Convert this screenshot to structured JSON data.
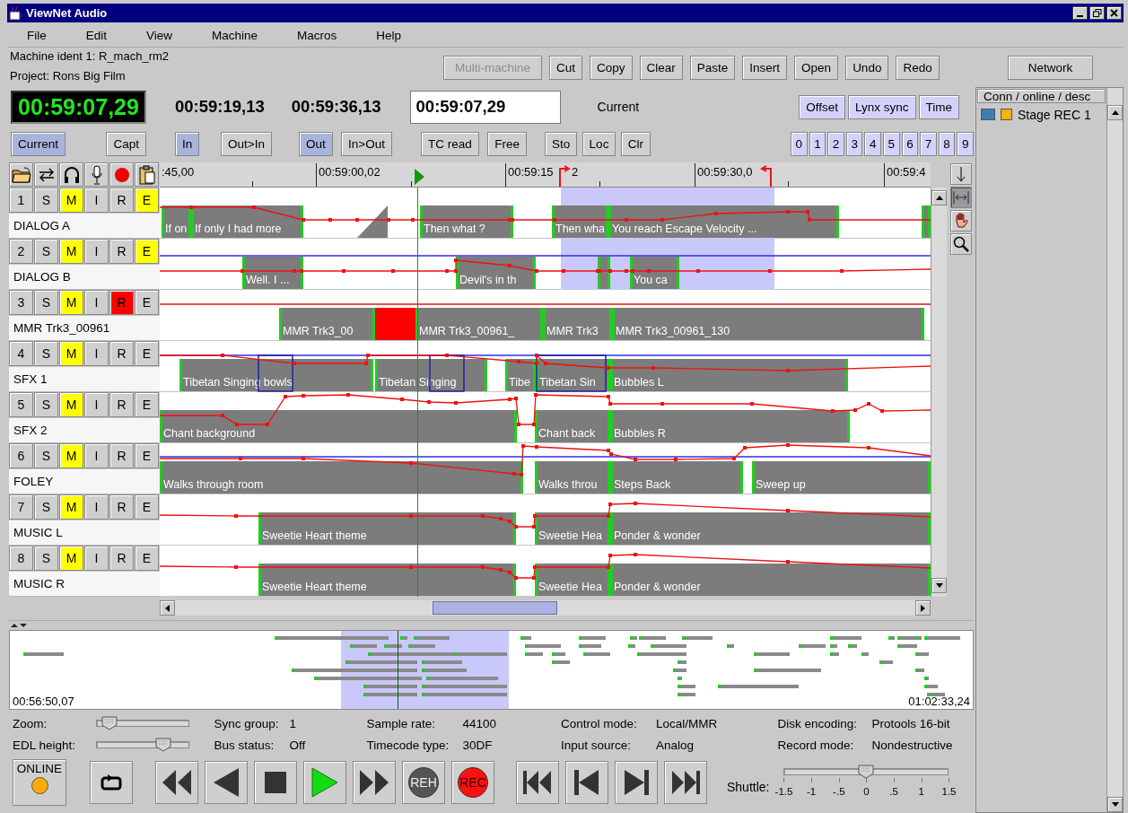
{
  "window": {
    "title": "ViewNet Audio"
  },
  "menu": [
    "File",
    "Edit",
    "View",
    "Machine",
    "Macros",
    "Help"
  ],
  "machine_ident": "Machine ident 1: R_mach_rm2",
  "project": "Project: Rons Big Film",
  "edit_buttons": [
    {
      "label": "Multi-machine",
      "disabled": true
    },
    {
      "label": "Cut",
      "disabled": false
    },
    {
      "label": "Copy",
      "disabled": false
    },
    {
      "label": "Clear",
      "disabled": false
    },
    {
      "label": "Paste",
      "disabled": false
    },
    {
      "label": "Insert",
      "disabled": false
    },
    {
      "label": "Open",
      "disabled": false
    },
    {
      "label": "Undo",
      "disabled": false
    },
    {
      "label": "Redo",
      "disabled": false
    }
  ],
  "network_button": "Network",
  "timecodes": {
    "current": "00:59:07,29",
    "in_point": "00:59:19,13",
    "out_point": "00:59:36,13",
    "entry": "00:59:07,29",
    "entry_label": "Current"
  },
  "sync_options": [
    "Offset",
    "Lynx sync",
    "Time"
  ],
  "point_groups": [
    [
      {
        "label": "Current",
        "selected": true
      },
      {
        "label": "Capt",
        "selected": false
      }
    ],
    [
      {
        "label": "In",
        "selected": true
      },
      {
        "label": "Out>In",
        "selected": false
      }
    ],
    [
      {
        "label": "Out",
        "selected": true
      },
      {
        "label": "In>Out",
        "selected": false
      }
    ],
    [
      {
        "label": "TC read",
        "selected": false
      },
      {
        "label": "Free",
        "selected": false
      }
    ],
    [
      {
        "label": "Sto",
        "selected": false
      },
      {
        "label": "Loc",
        "selected": false
      },
      {
        "label": "Clr",
        "selected": false
      }
    ]
  ],
  "locate_buttons": [
    "0",
    "1",
    "2",
    "3",
    "4",
    "5",
    "6",
    "7",
    "8",
    "9"
  ],
  "timeline": {
    "ruler": [
      ":45,00",
      "00:59:00,02",
      "00:59:15",
      "2",
      "00:59:30,0",
      "00:59:4"
    ],
    "tracks": [
      {
        "number": "1",
        "name": "DIALOG A",
        "buttons": [
          {
            "label": "S",
            "on": false
          },
          {
            "label": "M",
            "on": true
          },
          {
            "label": "I",
            "on": false
          },
          {
            "label": "R",
            "on": false
          },
          {
            "label": "E",
            "on": true
          }
        ],
        "clips": [
          {
            "kind": "audio",
            "label": "If on"
          },
          {
            "kind": "audio",
            "label": "If only I had more"
          },
          {
            "kind": "fade"
          },
          {
            "kind": "audio",
            "label": "Then what ?"
          },
          {
            "kind": "audio",
            "label": "Then wha"
          },
          {
            "kind": "audio",
            "label": "You reach Escape Velocity ..."
          },
          {
            "kind": "audio"
          }
        ]
      },
      {
        "number": "2",
        "name": "DIALOG B",
        "buttons": [
          {
            "label": "S",
            "on": false
          },
          {
            "label": "M",
            "on": true
          },
          {
            "label": "I",
            "on": false
          },
          {
            "label": "R",
            "on": false
          },
          {
            "label": "E",
            "on": true
          }
        ],
        "clips": [
          {
            "kind": "audio",
            "label": "Well. I ..."
          },
          {
            "kind": "audio",
            "label": "Devil's in th"
          },
          {
            "kind": "audio"
          },
          {
            "kind": "audio",
            "label": "You ca"
          }
        ]
      },
      {
        "number": "3",
        "name": "MMR Trk3_00961",
        "buttons": [
          {
            "label": "S",
            "on": false
          },
          {
            "label": "M",
            "on": true
          },
          {
            "label": "I",
            "on": false
          },
          {
            "label": "R",
            "on": true
          },
          {
            "label": "E",
            "on": false
          }
        ],
        "clips": [
          {
            "kind": "audio",
            "label": "MMR Trk3_00"
          },
          {
            "kind": "recording"
          },
          {
            "kind": "audio",
            "label": "MMR Trk3_00961_"
          },
          {
            "kind": "audio",
            "label": "MMR Trk3"
          },
          {
            "kind": "audio",
            "label": "MMR Trk3_00961_130"
          }
        ]
      },
      {
        "number": "4",
        "name": "SFX 1",
        "buttons": [
          {
            "label": "S",
            "on": false
          },
          {
            "label": "M",
            "on": true
          },
          {
            "label": "I",
            "on": false
          },
          {
            "label": "R",
            "on": false
          },
          {
            "label": "E",
            "on": false
          }
        ],
        "clips": [
          {
            "kind": "audio",
            "label": "Tibetan Singing bowls"
          },
          {
            "kind": "audio",
            "label": "Tibetan Singing"
          },
          {
            "kind": "audio",
            "label": "Tibe"
          },
          {
            "kind": "audio",
            "label": "Tibetan Sin"
          },
          {
            "kind": "audio",
            "label": "Bubbles L"
          }
        ]
      },
      {
        "number": "5",
        "name": "SFX 2",
        "buttons": [
          {
            "label": "S",
            "on": false
          },
          {
            "label": "M",
            "on": true
          },
          {
            "label": "I",
            "on": false
          },
          {
            "label": "R",
            "on": false
          },
          {
            "label": "E",
            "on": false
          }
        ],
        "clips": [
          {
            "kind": "audio",
            "label": "Chant background"
          },
          {
            "kind": "audio",
            "label": "Chant back"
          },
          {
            "kind": "audio",
            "label": "Bubbles R"
          }
        ]
      },
      {
        "number": "6",
        "name": "FOLEY",
        "buttons": [
          {
            "label": "S",
            "on": false
          },
          {
            "label": "M",
            "on": true
          },
          {
            "label": "I",
            "on": false
          },
          {
            "label": "R",
            "on": false
          },
          {
            "label": "E",
            "on": false
          }
        ],
        "clips": [
          {
            "kind": "audio",
            "label": "Walks through room"
          },
          {
            "kind": "audio",
            "label": "Walks throu"
          },
          {
            "kind": "audio",
            "label": "Steps Back"
          },
          {
            "kind": "audio",
            "label": "Sweep up"
          }
        ]
      },
      {
        "number": "7",
        "name": "MUSIC L",
        "buttons": [
          {
            "label": "S",
            "on": false
          },
          {
            "label": "M",
            "on": true
          },
          {
            "label": "I",
            "on": false
          },
          {
            "label": "R",
            "on": false
          },
          {
            "label": "E",
            "on": false
          }
        ],
        "clips": [
          {
            "kind": "audio",
            "label": "Sweetie Heart theme"
          },
          {
            "kind": "audio",
            "label": "Sweetie Hea"
          },
          {
            "kind": "audio",
            "label": "Ponder & wonder"
          }
        ]
      },
      {
        "number": "8",
        "name": "MUSIC R",
        "buttons": [
          {
            "label": "S",
            "on": false
          },
          {
            "label": "M",
            "on": true
          },
          {
            "label": "I",
            "on": false
          },
          {
            "label": "R",
            "on": false
          },
          {
            "label": "E",
            "on": false
          }
        ],
        "clips": [
          {
            "kind": "audio",
            "label": "Sweetie Heart theme"
          },
          {
            "kind": "audio",
            "label": "Sweetie Hea"
          },
          {
            "kind": "audio",
            "label": "Ponder & wonder"
          }
        ]
      }
    ]
  },
  "overview": {
    "start": "00:56:50,07",
    "end": "01:02:33,24"
  },
  "sliders": [
    {
      "label": "Zoom:",
      "level": 0.14
    },
    {
      "label": "EDL height:",
      "level": 0.73
    }
  ],
  "status_columns": [
    [
      {
        "label": "Sync group:",
        "value": "1"
      },
      {
        "label": "Bus status:",
        "value": "Off"
      }
    ],
    [
      {
        "label": "Sample rate:",
        "value": "44100"
      },
      {
        "label": "Timecode type:",
        "value": "30DF"
      }
    ],
    [
      {
        "label": "Control mode:",
        "value": "Local/MMR"
      },
      {
        "label": "Input source:",
        "value": "Analog"
      }
    ],
    [
      {
        "label": "Disk encoding:",
        "value": "Protools 16-bit"
      },
      {
        "label": "Record mode:",
        "value": "Nondestructive"
      }
    ]
  ],
  "transport": {
    "online": {
      "label": "ONLINE",
      "lit": true
    },
    "buttons": [
      {
        "kind": "loop"
      },
      {
        "kind": "rewind"
      },
      {
        "kind": "back"
      },
      {
        "kind": "stop"
      },
      {
        "kind": "play"
      },
      {
        "kind": "fast-forward"
      },
      {
        "kind": "rehearse",
        "label": "REH"
      },
      {
        "kind": "record",
        "label": "REC"
      },
      {
        "kind": "go-start"
      },
      {
        "kind": "previous"
      },
      {
        "kind": "next"
      },
      {
        "kind": "go-end"
      }
    ]
  },
  "shuttle": {
    "label": "Shuttle:",
    "level": 0.5,
    "ticks": [
      "-1.5",
      "-1",
      "-.5",
      "0",
      ".5",
      "1",
      "1.5"
    ]
  },
  "connections": {
    "header": "Conn / online / desc",
    "rows": [
      {
        "label": "Stage REC 1",
        "connected": true,
        "online": true
      }
    ]
  }
}
